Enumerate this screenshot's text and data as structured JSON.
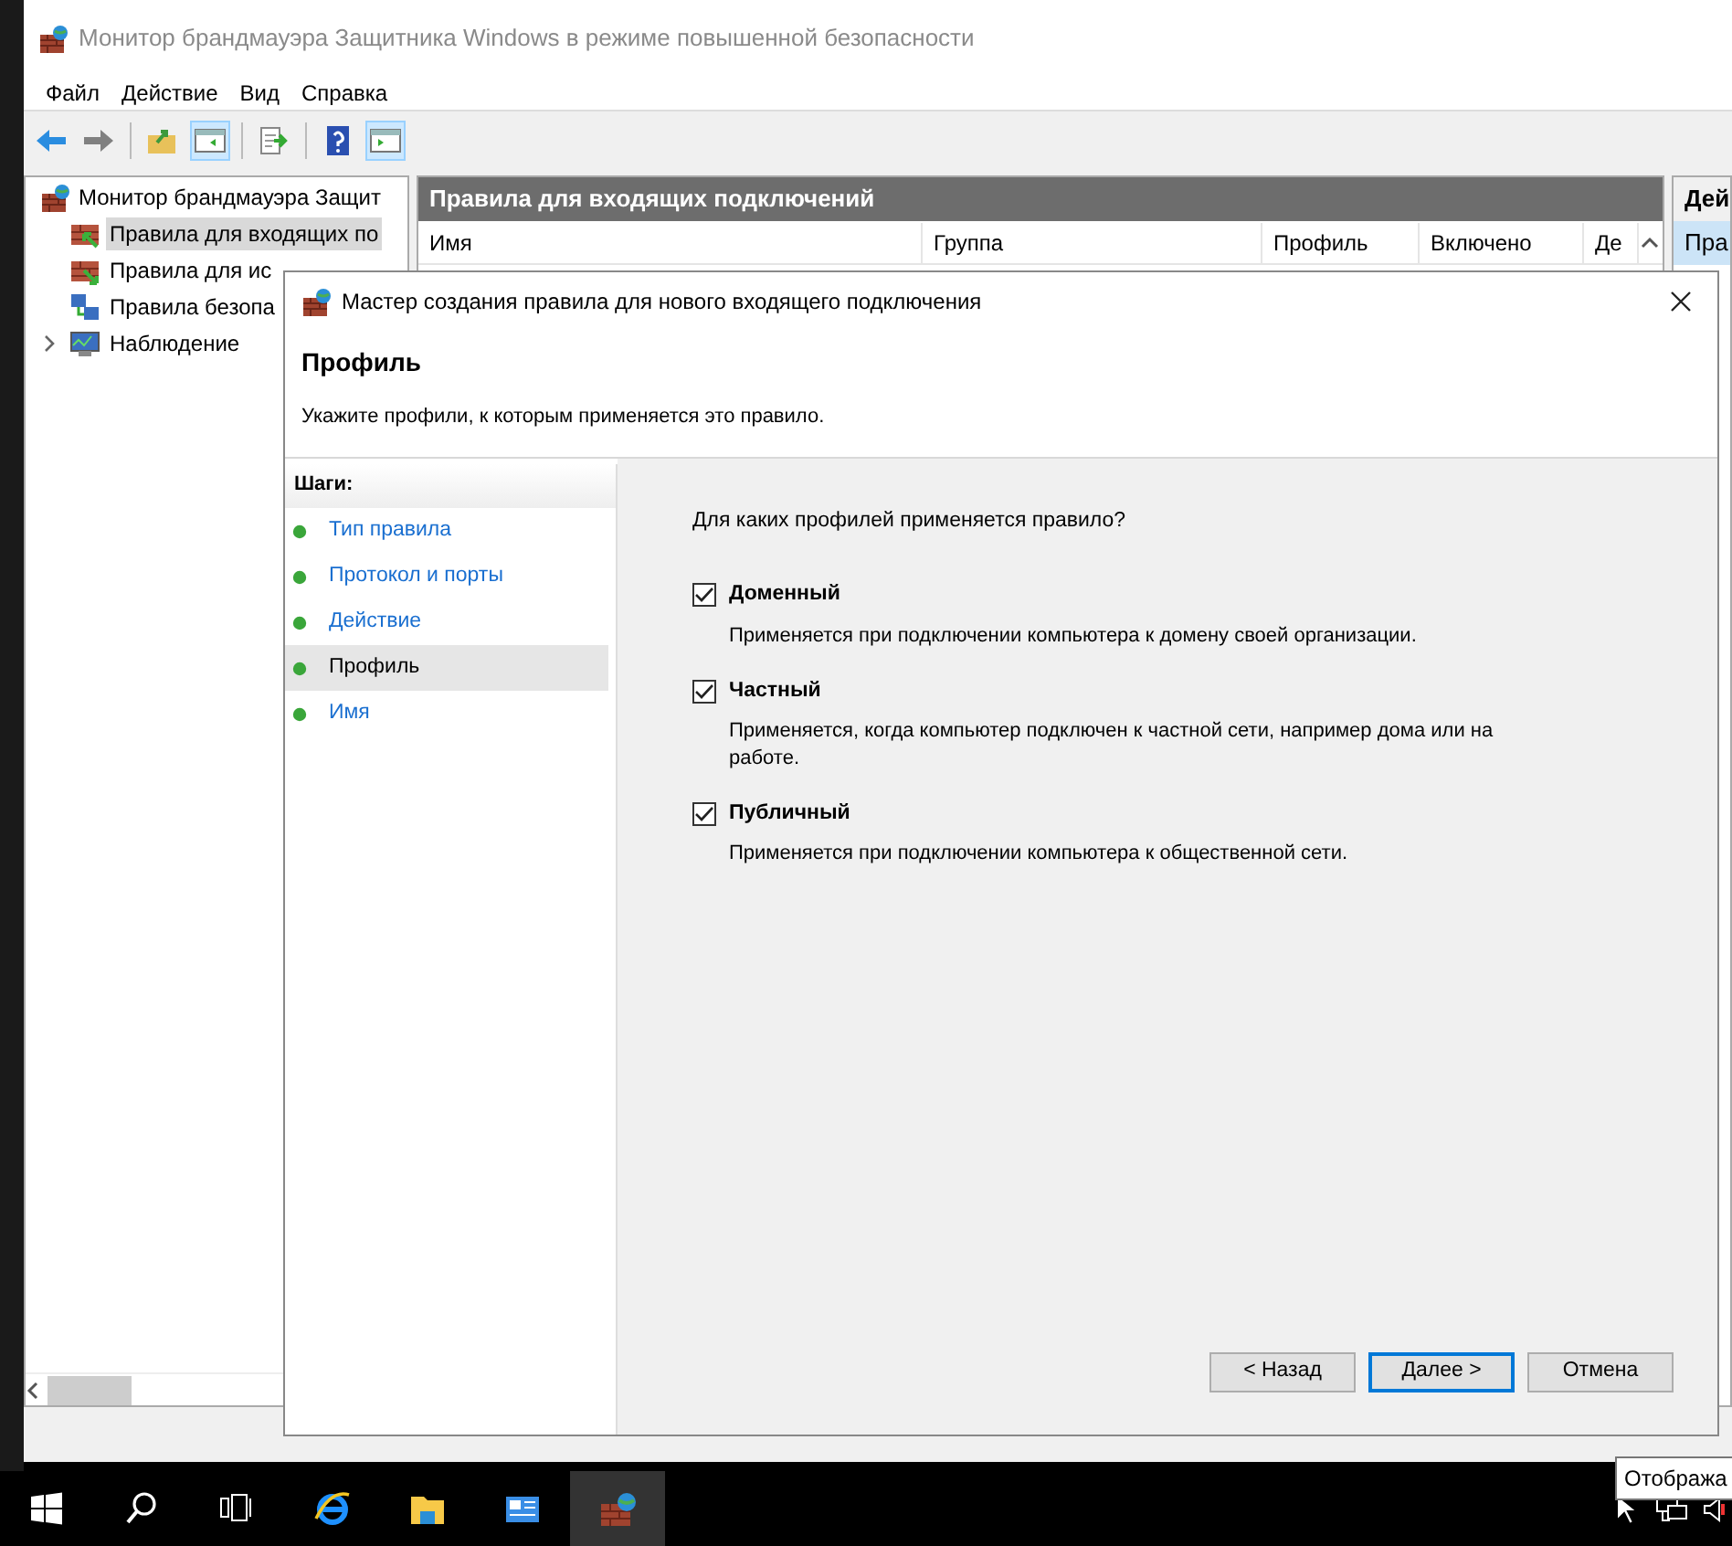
{
  "window": {
    "title": "Монитор брандмауэра Защитника Windows в режиме повышенной безопасности"
  },
  "menu": [
    "Файл",
    "Действие",
    "Вид",
    "Справка"
  ],
  "tree": {
    "label": "Монитор брандмауэра Защит",
    "children": [
      {
        "label": "Правила для входящих по",
        "kind": "inbound",
        "selected": true
      },
      {
        "label": "Правила для ис",
        "kind": "outbound",
        "selected": false
      },
      {
        "label": "Правила безопа",
        "kind": "security",
        "selected": false
      },
      {
        "label": "Наблюдение",
        "kind": "monitor",
        "selected": false,
        "expanded": false
      }
    ]
  },
  "center": {
    "title": "Правила для входящих подключений",
    "columns": [
      "Имя",
      "Группа",
      "Профиль",
      "Включено",
      "Де"
    ]
  },
  "actions": {
    "title": "Дей",
    "items": [
      "Пра"
    ]
  },
  "dialog": {
    "title": "Мастер создания правила для нового входящего подключения",
    "heading": "Профиль",
    "subtitle": "Укажите профили, к которым применяется это правило.",
    "steps_title": "Шаги:",
    "steps": [
      {
        "label": "Тип правила",
        "selected": false
      },
      {
        "label": "Протокол и порты",
        "selected": false
      },
      {
        "label": "Действие",
        "selected": false
      },
      {
        "label": "Профиль",
        "selected": true
      },
      {
        "label": "Имя",
        "selected": false
      }
    ],
    "question": "Для каких профилей применяется правило?",
    "options": [
      {
        "label": "Доменный",
        "description": "Применяется при подключении компьютера к домену своей организации.",
        "checked": true
      },
      {
        "label": "Частный",
        "description": "Применяется, когда компьютер подключен к частной сети, например дома или на работе.",
        "checked": true
      },
      {
        "label": "Публичный",
        "description": "Применяется при подключении компьютера к общественной сети.",
        "checked": true
      }
    ],
    "buttons": [
      {
        "label": "< Назад",
        "default": false
      },
      {
        "label": "Далее >",
        "default": true
      },
      {
        "label": "Отмена",
        "default": false
      }
    ]
  },
  "taskbar": {
    "apps": [
      {
        "kind": "start",
        "selected": false
      },
      {
        "kind": "search",
        "selected": false
      },
      {
        "kind": "taskview",
        "selected": false
      },
      {
        "kind": "browser",
        "selected": false
      },
      {
        "kind": "folder",
        "selected": false
      },
      {
        "kind": "server",
        "selected": false
      },
      {
        "kind": "firewall",
        "selected": true
      }
    ]
  },
  "tooltip": "Отобража"
}
